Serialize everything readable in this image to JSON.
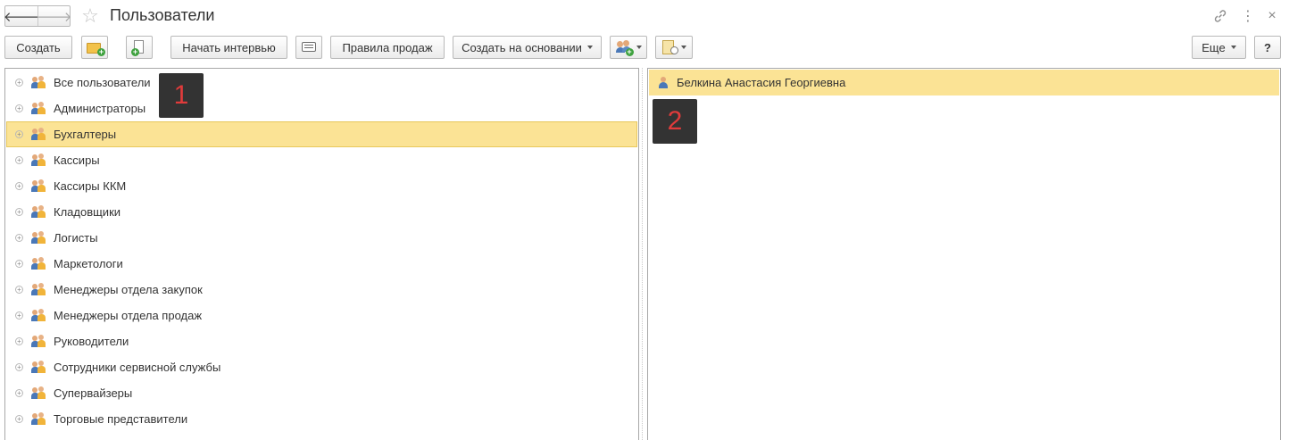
{
  "window": {
    "title": "Пользователи",
    "icons": {
      "back": "arrow-left-icon",
      "forward": "arrow-right-icon",
      "favorite": "star-icon",
      "link": "link-icon",
      "more": "more-vertical-icon",
      "close": "close-icon"
    }
  },
  "toolbar": {
    "create_label": "Создать",
    "start_interview_label": "Начать интервью",
    "sales_rules_label": "Правила продаж",
    "create_based_on_label": "Создать на основании",
    "more_label": "Еще",
    "help_label": "?"
  },
  "groups": [
    {
      "label": "Все пользователи",
      "selected": false
    },
    {
      "label": "Администраторы",
      "selected": false
    },
    {
      "label": "Бухгалтеры",
      "selected": true
    },
    {
      "label": "Кассиры",
      "selected": false
    },
    {
      "label": "Кассиры ККМ",
      "selected": false
    },
    {
      "label": "Кладовщики",
      "selected": false
    },
    {
      "label": "Логисты",
      "selected": false
    },
    {
      "label": "Маркетологи",
      "selected": false
    },
    {
      "label": "Менеджеры отдела закупок",
      "selected": false
    },
    {
      "label": "Менеджеры отдела продаж",
      "selected": false
    },
    {
      "label": "Руководители",
      "selected": false
    },
    {
      "label": "Сотрудники сервисной службы",
      "selected": false
    },
    {
      "label": "Супервайзеры",
      "selected": false
    },
    {
      "label": "Торговые представители",
      "selected": false
    }
  ],
  "users": [
    {
      "name": "Белкина Анастасия Георгиевна",
      "selected": true
    }
  ],
  "callouts": {
    "groups": "1",
    "users": "2"
  },
  "colors": {
    "selection": "#fbe395",
    "callout_bg": "#333333",
    "callout_text": "#e03b3b"
  }
}
